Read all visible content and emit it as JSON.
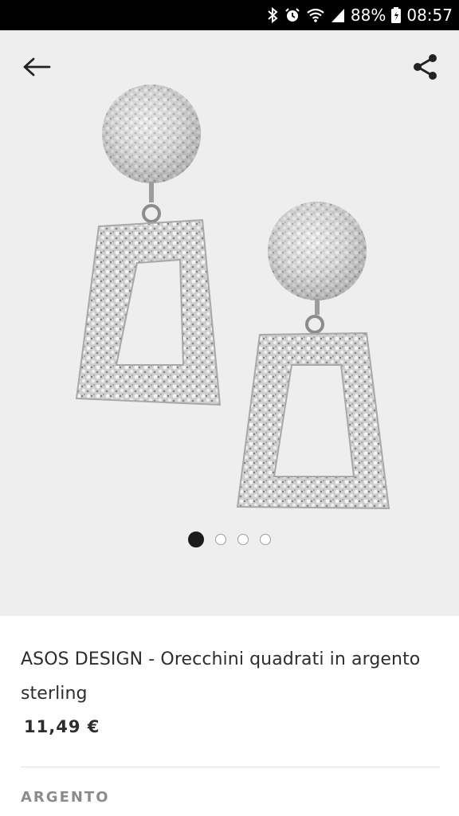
{
  "status_bar": {
    "battery": "88%",
    "time": "08:57",
    "icons": [
      "bluetooth-icon",
      "alarm-icon",
      "wifi-icon",
      "signal-icon",
      "battery-icon"
    ]
  },
  "header": {
    "back_icon": "arrow-left-icon",
    "share_icon": "share-icon"
  },
  "carousel": {
    "image_subject": "silver textured square drop earrings",
    "total_images": 4,
    "active_index": 0
  },
  "product": {
    "title": "ASOS DESIGN - Orecchini quadrati in argento sterling",
    "price": "11,49 €",
    "color_label": "ARGENTO"
  },
  "colors": {
    "status_bar_bg": "#000000",
    "image_bg": "#eeeeee",
    "text": "#2d2d2d",
    "muted": "#8c8c8c",
    "active_dot": "#1c1c1c"
  }
}
